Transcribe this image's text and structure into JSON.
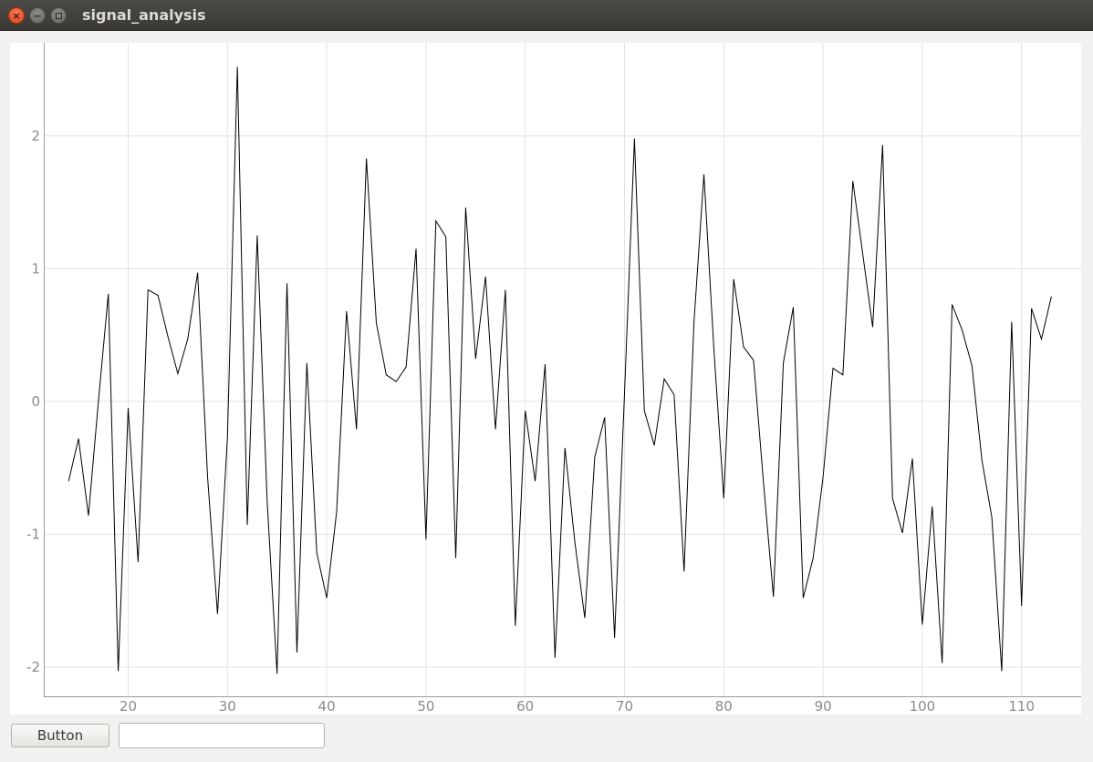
{
  "window": {
    "title": "signal_analysis"
  },
  "controls": {
    "button_label": "Button",
    "text_value": "",
    "text_placeholder": ""
  },
  "colors": {
    "titlebar": "#3c3b37",
    "close_button": "#e9541f",
    "plot_background": "#ffffff",
    "grid": "#e3e3e3",
    "series_line": "#000000",
    "tick_label": "#8a8a8a"
  },
  "chart_data": {
    "type": "line",
    "title": "",
    "xlabel": "",
    "ylabel": "",
    "xlim": [
      11.5,
      116
    ],
    "ylim": [
      -2.22,
      2.7
    ],
    "xticks": [
      20,
      30,
      40,
      50,
      60,
      70,
      80,
      90,
      100,
      110
    ],
    "yticks": [
      -2,
      -1,
      0,
      1,
      2
    ],
    "grid": true,
    "legend": "none",
    "series": [
      {
        "x": [
          14,
          15,
          16,
          17,
          18,
          19,
          20,
          21,
          22,
          23,
          24,
          25,
          26,
          27,
          28,
          29,
          30,
          31,
          32,
          33,
          34,
          35,
          36,
          37,
          38,
          39,
          40,
          41,
          42,
          43,
          44,
          45,
          46,
          47,
          48,
          49,
          50,
          51,
          52,
          53,
          54,
          55,
          56,
          57,
          58,
          59,
          60,
          61,
          62,
          63,
          64,
          65,
          66,
          67,
          68,
          69,
          70,
          71,
          72,
          73,
          74,
          75,
          76,
          77,
          78,
          79,
          80,
          81,
          82,
          83,
          84,
          85,
          86,
          87,
          88,
          89,
          90,
          91,
          92,
          93,
          94,
          95,
          96,
          97,
          98,
          99,
          100,
          101,
          102,
          103,
          104,
          105,
          106,
          107,
          108,
          109,
          110,
          111,
          112,
          113
        ],
        "y": [
          -0.6,
          -0.28,
          -0.86,
          0.0,
          0.81,
          -2.03,
          -0.05,
          -1.21,
          0.84,
          0.8,
          0.49,
          0.21,
          0.47,
          0.97,
          -0.57,
          -1.6,
          -0.27,
          2.52,
          -0.93,
          1.25,
          -0.75,
          -2.05,
          0.89,
          -1.89,
          0.29,
          -1.14,
          -1.48,
          -0.83,
          0.68,
          -0.21,
          1.83,
          0.59,
          0.2,
          0.15,
          0.26,
          1.15,
          -1.04,
          1.36,
          1.24,
          -1.18,
          1.46,
          0.32,
          0.94,
          -0.21,
          0.84,
          -1.69,
          -0.07,
          -0.6,
          0.28,
          -1.93,
          -0.35,
          -1.06,
          -1.63,
          -0.42,
          -0.12,
          -1.78,
          0.06,
          1.98,
          -0.07,
          -0.33,
          0.17,
          0.05,
          -1.28,
          0.6,
          1.71,
          0.4,
          -0.73,
          0.92,
          0.41,
          0.31,
          -0.61,
          -1.47,
          0.29,
          0.71,
          -1.48,
          -1.18,
          -0.57,
          0.25,
          0.2,
          1.66,
          1.11,
          0.56,
          1.93,
          -0.73,
          -0.99,
          -0.43,
          -1.68,
          -0.79,
          -1.97,
          0.73,
          0.54,
          0.27,
          -0.44,
          -0.87,
          -2.03,
          0.6,
          -1.54,
          0.7,
          0.47,
          0.79
        ]
      }
    ]
  }
}
